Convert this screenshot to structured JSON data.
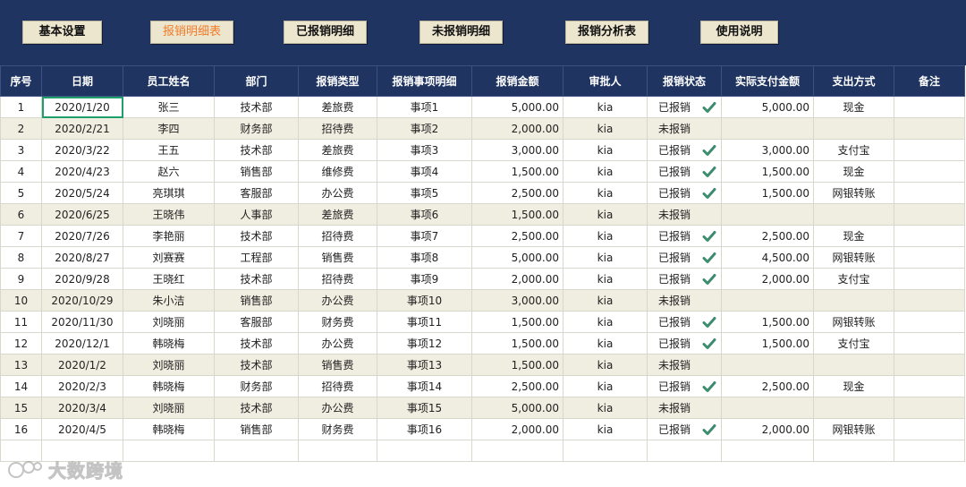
{
  "nav": {
    "buttons": [
      {
        "label": "基本设置",
        "active": false
      },
      {
        "label": "报销明细表",
        "active": true
      },
      {
        "label": "已报销明细",
        "active": false
      },
      {
        "label": "未报销明细",
        "active": false
      },
      {
        "label": "报销分析表",
        "active": false
      },
      {
        "label": "使用说明",
        "active": false
      }
    ]
  },
  "table": {
    "headers": [
      "序号",
      "日期",
      "员工姓名",
      "部门",
      "报销类型",
      "报销事项明细",
      "报销金额",
      "审批人",
      "报销状态",
      "实际支付金额",
      "支出方式",
      "备注"
    ],
    "rows": [
      {
        "no": "1",
        "date": "2020/1/20",
        "name": "张三",
        "dept": "技术部",
        "type": "差旅费",
        "detail": "事项1",
        "amount": "5,000.00",
        "approver": "kia",
        "status": "已报销",
        "paid": "5,000.00",
        "method": "现金",
        "note": ""
      },
      {
        "no": "2",
        "date": "2020/2/21",
        "name": "李四",
        "dept": "财务部",
        "type": "招待费",
        "detail": "事项2",
        "amount": "2,000.00",
        "approver": "kia",
        "status": "未报销",
        "paid": "",
        "method": "",
        "note": ""
      },
      {
        "no": "3",
        "date": "2020/3/22",
        "name": "王五",
        "dept": "技术部",
        "type": "差旅费",
        "detail": "事项3",
        "amount": "3,000.00",
        "approver": "kia",
        "status": "已报销",
        "paid": "3,000.00",
        "method": "支付宝",
        "note": ""
      },
      {
        "no": "4",
        "date": "2020/4/23",
        "name": "赵六",
        "dept": "销售部",
        "type": "维修费",
        "detail": "事项4",
        "amount": "1,500.00",
        "approver": "kia",
        "status": "已报销",
        "paid": "1,500.00",
        "method": "现金",
        "note": ""
      },
      {
        "no": "5",
        "date": "2020/5/24",
        "name": "亮琪琪",
        "dept": "客服部",
        "type": "办公费",
        "detail": "事项5",
        "amount": "2,500.00",
        "approver": "kia",
        "status": "已报销",
        "paid": "1,500.00",
        "method": "网银转账",
        "note": ""
      },
      {
        "no": "6",
        "date": "2020/6/25",
        "name": "王晓伟",
        "dept": "人事部",
        "type": "差旅费",
        "detail": "事项6",
        "amount": "1,500.00",
        "approver": "kia",
        "status": "未报销",
        "paid": "",
        "method": "",
        "note": ""
      },
      {
        "no": "7",
        "date": "2020/7/26",
        "name": "李艳丽",
        "dept": "技术部",
        "type": "招待费",
        "detail": "事项7",
        "amount": "2,500.00",
        "approver": "kia",
        "status": "已报销",
        "paid": "2,500.00",
        "method": "现金",
        "note": ""
      },
      {
        "no": "8",
        "date": "2020/8/27",
        "name": "刘赛赛",
        "dept": "工程部",
        "type": "销售费",
        "detail": "事项8",
        "amount": "5,000.00",
        "approver": "kia",
        "status": "已报销",
        "paid": "4,500.00",
        "method": "网银转账",
        "note": ""
      },
      {
        "no": "9",
        "date": "2020/9/28",
        "name": "王晓红",
        "dept": "技术部",
        "type": "招待费",
        "detail": "事项9",
        "amount": "2,000.00",
        "approver": "kia",
        "status": "已报销",
        "paid": "2,000.00",
        "method": "支付宝",
        "note": ""
      },
      {
        "no": "10",
        "date": "2020/10/29",
        "name": "朱小洁",
        "dept": "销售部",
        "type": "办公费",
        "detail": "事项10",
        "amount": "3,000.00",
        "approver": "kia",
        "status": "未报销",
        "paid": "",
        "method": "",
        "note": ""
      },
      {
        "no": "11",
        "date": "2020/11/30",
        "name": "刘晓丽",
        "dept": "客服部",
        "type": "财务费",
        "detail": "事项11",
        "amount": "1,500.00",
        "approver": "kia",
        "status": "已报销",
        "paid": "1,500.00",
        "method": "网银转账",
        "note": ""
      },
      {
        "no": "12",
        "date": "2020/12/1",
        "name": "韩晓梅",
        "dept": "技术部",
        "type": "办公费",
        "detail": "事项12",
        "amount": "1,500.00",
        "approver": "kia",
        "status": "已报销",
        "paid": "1,500.00",
        "method": "支付宝",
        "note": ""
      },
      {
        "no": "13",
        "date": "2020/1/2",
        "name": "刘晓丽",
        "dept": "技术部",
        "type": "销售费",
        "detail": "事项13",
        "amount": "1,500.00",
        "approver": "kia",
        "status": "未报销",
        "paid": "",
        "method": "",
        "note": ""
      },
      {
        "no": "14",
        "date": "2020/2/3",
        "name": "韩晓梅",
        "dept": "财务部",
        "type": "招待费",
        "detail": "事项14",
        "amount": "2,500.00",
        "approver": "kia",
        "status": "已报销",
        "paid": "2,500.00",
        "method": "现金",
        "note": ""
      },
      {
        "no": "15",
        "date": "2020/3/4",
        "name": "刘晓丽",
        "dept": "技术部",
        "type": "办公费",
        "detail": "事项15",
        "amount": "5,000.00",
        "approver": "kia",
        "status": "未报销",
        "paid": "",
        "method": "",
        "note": ""
      },
      {
        "no": "16",
        "date": "2020/4/5",
        "name": "韩晓梅",
        "dept": "销售部",
        "type": "财务费",
        "detail": "事项16",
        "amount": "2,000.00",
        "approver": "kia",
        "status": "已报销",
        "paid": "2,000.00",
        "method": "网银转账",
        "note": ""
      }
    ]
  },
  "watermark": {
    "text": "大数跨境"
  },
  "colors": {
    "header_bg": "#1f3461",
    "nav_button_bg": "#ede6cf",
    "nav_active_text": "#f07b2a",
    "shaded_row": "#f0ede1",
    "check_mark": "#3c8c6e",
    "selection": "#1e9e6a"
  },
  "icons": {
    "check": "check-icon"
  }
}
